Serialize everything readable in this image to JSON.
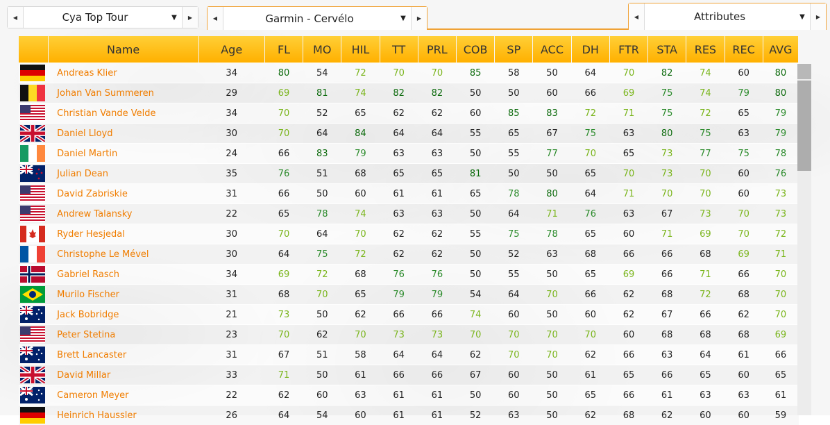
{
  "selectors": {
    "race": "Cya Top Tour",
    "team": "Garmin - Cervélo",
    "view": "Attributes"
  },
  "columns": [
    "Name",
    "Age",
    "FL",
    "MO",
    "HIL",
    "TT",
    "PRL",
    "COB",
    "SP",
    "ACC",
    "DH",
    "FTR",
    "STA",
    "RES",
    "REC",
    "AVG"
  ],
  "riders": [
    {
      "flag": "germany-flag",
      "name": "Andreas Klier",
      "age": "34",
      "stats": [
        "80",
        "54",
        "72",
        "70",
        "70",
        "85",
        "58",
        "50",
        "64",
        "70",
        "82",
        "74",
        "60",
        "80"
      ]
    },
    {
      "flag": "belgium-flag",
      "name": "Johan Van Summeren",
      "age": "29",
      "stats": [
        "69",
        "81",
        "74",
        "82",
        "82",
        "50",
        "50",
        "60",
        "66",
        "69",
        "75",
        "74",
        "79",
        "80"
      ]
    },
    {
      "flag": "usa-flag",
      "name": "Christian Vande Velde",
      "age": "34",
      "stats": [
        "70",
        "52",
        "65",
        "62",
        "62",
        "60",
        "85",
        "83",
        "72",
        "71",
        "75",
        "72",
        "65",
        "79"
      ]
    },
    {
      "flag": "uk-flag",
      "name": "Daniel Lloyd",
      "age": "30",
      "stats": [
        "70",
        "64",
        "84",
        "64",
        "64",
        "55",
        "65",
        "67",
        "75",
        "63",
        "80",
        "75",
        "63",
        "79"
      ]
    },
    {
      "flag": "ireland-flag",
      "name": "Daniel Martin",
      "age": "24",
      "stats": [
        "66",
        "83",
        "79",
        "63",
        "63",
        "50",
        "55",
        "77",
        "70",
        "65",
        "73",
        "77",
        "75",
        "78"
      ]
    },
    {
      "flag": "new-zealand-flag",
      "name": "Julian Dean",
      "age": "35",
      "stats": [
        "76",
        "51",
        "68",
        "65",
        "65",
        "81",
        "50",
        "50",
        "65",
        "70",
        "73",
        "70",
        "60",
        "76"
      ]
    },
    {
      "flag": "usa-flag",
      "name": "David Zabriskie",
      "age": "31",
      "stats": [
        "66",
        "50",
        "60",
        "61",
        "61",
        "65",
        "78",
        "80",
        "64",
        "71",
        "70",
        "70",
        "60",
        "73"
      ]
    },
    {
      "flag": "usa-flag",
      "name": "Andrew Talansky",
      "age": "22",
      "stats": [
        "65",
        "78",
        "74",
        "63",
        "63",
        "50",
        "64",
        "71",
        "76",
        "63",
        "67",
        "73",
        "70",
        "73"
      ]
    },
    {
      "flag": "canada-flag",
      "name": "Ryder Hesjedal",
      "age": "30",
      "stats": [
        "70",
        "64",
        "70",
        "62",
        "62",
        "55",
        "75",
        "78",
        "65",
        "60",
        "71",
        "69",
        "70",
        "72"
      ]
    },
    {
      "flag": "france-flag",
      "name": "Christophe Le Mével",
      "age": "30",
      "stats": [
        "64",
        "75",
        "72",
        "62",
        "62",
        "50",
        "52",
        "63",
        "68",
        "66",
        "66",
        "68",
        "69",
        "71"
      ]
    },
    {
      "flag": "norway-flag",
      "name": "Gabriel Rasch",
      "age": "34",
      "stats": [
        "69",
        "72",
        "68",
        "76",
        "76",
        "50",
        "55",
        "50",
        "65",
        "69",
        "66",
        "71",
        "66",
        "70"
      ]
    },
    {
      "flag": "brazil-flag",
      "name": "Murilo Fischer",
      "age": "31",
      "stats": [
        "68",
        "70",
        "65",
        "79",
        "79",
        "54",
        "64",
        "70",
        "66",
        "62",
        "68",
        "72",
        "68",
        "70"
      ]
    },
    {
      "flag": "australia-flag",
      "name": "Jack Bobridge",
      "age": "21",
      "stats": [
        "73",
        "50",
        "62",
        "66",
        "66",
        "74",
        "60",
        "50",
        "60",
        "62",
        "67",
        "66",
        "62",
        "70"
      ]
    },
    {
      "flag": "usa-flag",
      "name": "Peter Stetina",
      "age": "23",
      "stats": [
        "70",
        "62",
        "70",
        "73",
        "73",
        "70",
        "70",
        "70",
        "70",
        "60",
        "68",
        "68",
        "68",
        "69"
      ]
    },
    {
      "flag": "australia-flag",
      "name": "Brett Lancaster",
      "age": "31",
      "stats": [
        "67",
        "51",
        "58",
        "64",
        "64",
        "62",
        "70",
        "70",
        "62",
        "66",
        "63",
        "64",
        "61",
        "66"
      ]
    },
    {
      "flag": "uk-flag",
      "name": "David Millar",
      "age": "33",
      "stats": [
        "71",
        "50",
        "61",
        "66",
        "66",
        "67",
        "60",
        "50",
        "61",
        "65",
        "66",
        "65",
        "60",
        "65"
      ]
    },
    {
      "flag": "australia-flag",
      "name": "Cameron Meyer",
      "age": "22",
      "stats": [
        "62",
        "60",
        "63",
        "61",
        "61",
        "50",
        "60",
        "50",
        "65",
        "66",
        "61",
        "63",
        "63",
        "61"
      ]
    },
    {
      "flag": "germany-flag",
      "name": "Heinrich Haussler",
      "age": "26",
      "stats": [
        "64",
        "54",
        "60",
        "61",
        "61",
        "52",
        "63",
        "50",
        "62",
        "68",
        "62",
        "60",
        "60",
        "59"
      ]
    }
  ],
  "colors": {
    "header": "#ffb000",
    "name_text": "#f07d00",
    "good": "#7ab51c",
    "very_good": "#2a8a2a",
    "excellent": "#0d6b0d"
  }
}
